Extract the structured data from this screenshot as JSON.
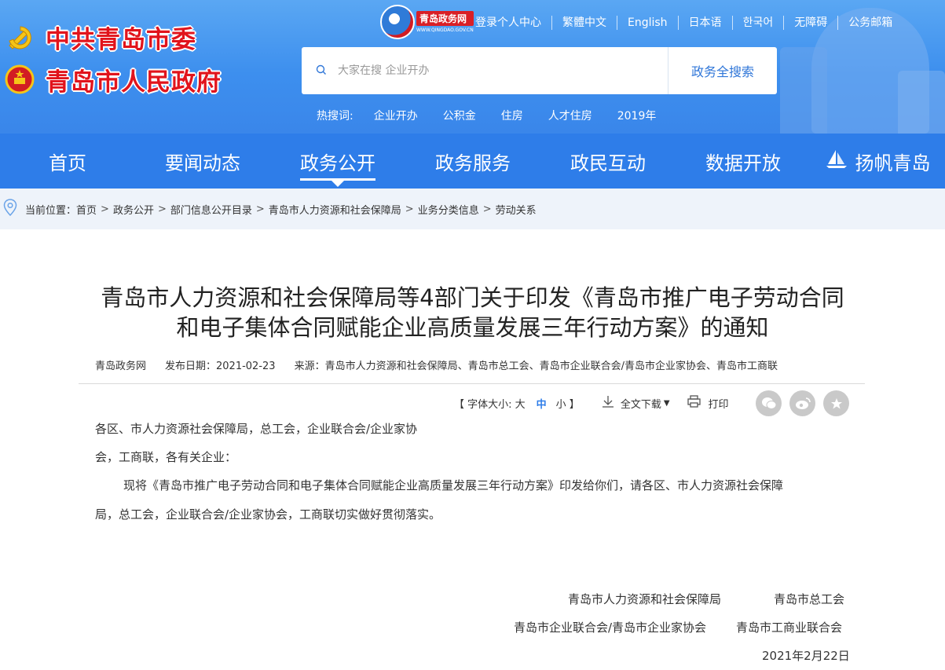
{
  "header": {
    "party_committee": "中共青岛市委",
    "government": "青岛市人民政府",
    "portal_logo": {
      "name": "青岛政务网",
      "domain": "WWW.QINGDAO.GOV.CN"
    },
    "top_links": [
      "登录个人中心",
      "繁體中文",
      "English",
      "日本语",
      "한국어",
      "无障碍",
      "公务邮箱"
    ],
    "search": {
      "placeholder": "大家在搜 企业开办",
      "button": "政务全搜索"
    },
    "hot_search": {
      "label": "热搜词:",
      "terms": [
        "企业开办",
        "公积金",
        "住房",
        "人才住房",
        "2019年"
      ]
    }
  },
  "nav": {
    "items": [
      "首页",
      "要闻动态",
      "政务公开",
      "政务服务",
      "政民互动",
      "数据开放",
      "扬帆青岛"
    ],
    "active_index": 2
  },
  "breadcrumb": {
    "label": "当前位置：",
    "items": [
      "首页",
      "政务公开",
      "部门信息公开目录",
      "青岛市人力资源和社会保障局",
      "业务分类信息",
      "劳动关系"
    ]
  },
  "article": {
    "title_line1": "青岛市人力资源和社会保障局等4部门关于印发《青岛市推广电子劳动合同",
    "title_line2": "和电子集体合同赋能企业高质量发展三年行动方案》的通知",
    "meta": {
      "site": "青岛政务网",
      "date_label": "发布日期：2021-02-23",
      "source_label": "来源：青岛市人力资源和社会保障局、青岛市总工会、青岛市企业联合会/青岛市企业家协会、青岛市工商联"
    },
    "tools": {
      "font_size_open": "【 字体大小: 大",
      "font_size_mid": "中",
      "font_size_close": "小 】",
      "download": "全文下载",
      "print": "打印"
    },
    "share_icons": [
      "wechat-icon",
      "weibo-icon",
      "favorite-icon"
    ],
    "paragraphs": [
      "各区、市人力资源社会保障局，总工会，企业联合会/企业家协",
      "会，工商联，各有关企业：",
      "现将《青岛市推广电子劳动合同和电子集体合同赋能企业高质量发展三年行动方案》印发给你们，请各区、市人力资源社会保障",
      "局，总工会，企业联合会/企业家协会，工商联切实做好贯彻落实。"
    ],
    "signatures": {
      "line1_a": "青岛市人力资源和社会保障局",
      "line1_b": "青岛市总工会",
      "line2_a": "青岛市企业联合会/青岛市企业家协会",
      "line2_b": "青岛市工商业联合会",
      "date": "2021年2月22日"
    }
  },
  "colors": {
    "header_blue": "#3d8fee",
    "nav_blue": "#2e7de9",
    "red": "#e1141c"
  }
}
